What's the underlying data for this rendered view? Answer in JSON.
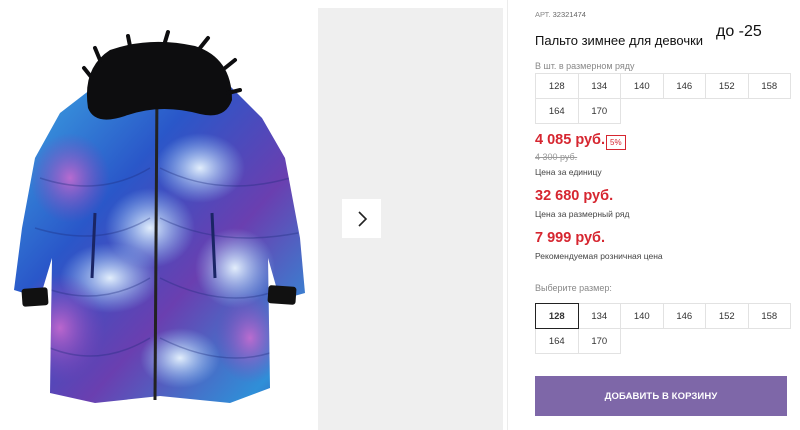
{
  "product": {
    "article_label": "АРТ.",
    "article_code": "32321474",
    "title": "Пальто зимнее для девочки",
    "promo_note": "до -25"
  },
  "size_row": {
    "label": "В шт. в размерном ряду",
    "sizes": [
      "128",
      "134",
      "140",
      "146",
      "152",
      "158",
      "164",
      "170"
    ]
  },
  "pricing": {
    "unit_price": "4 085 руб.",
    "discount_badge": "5%",
    "old_price": "4 300 руб.",
    "unit_label": "Цена за единицу",
    "row_price": "32 680 руб.",
    "row_label": "Цена за размерный ряд",
    "retail_price": "7 999 руб.",
    "retail_label": "Рекомендуемая розничная цена"
  },
  "size_select": {
    "label": "Выберите размер:",
    "sizes": [
      "128",
      "134",
      "140",
      "146",
      "152",
      "158",
      "164",
      "170"
    ],
    "selected": "128"
  },
  "cart": {
    "button_label": "ДОБАВИТЬ В КОРЗИНУ"
  },
  "gallery": {
    "next_icon": "chevron-right-icon"
  },
  "colors": {
    "price_red": "#d62630",
    "button_purple": "#7e67a8"
  }
}
